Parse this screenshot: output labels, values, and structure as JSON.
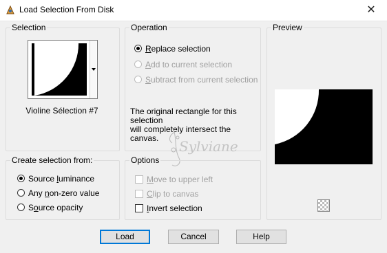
{
  "window": {
    "title": "Load Selection From Disk",
    "close_symbol": "✕",
    "app_icon": "paintshop-app-icon"
  },
  "selection": {
    "group_label": "Selection",
    "name": "Violine Sélection #7"
  },
  "operation": {
    "group_label": "Operation",
    "options": [
      {
        "pre": "",
        "u": "R",
        "post": "eplace selection",
        "checked": true,
        "enabled": true
      },
      {
        "pre": "",
        "u": "A",
        "post": "dd to current selection",
        "checked": false,
        "enabled": false
      },
      {
        "pre": "",
        "u": "S",
        "post": "ubtract from current selection",
        "checked": false,
        "enabled": false
      }
    ],
    "info_line1": "The original rectangle for this selection",
    "info_line2": "will completely intersect the canvas."
  },
  "preview": {
    "group_label": "Preview",
    "transparency_icon": "checkerboard-icon"
  },
  "create_from": {
    "group_label": "Create selection from:",
    "options": [
      {
        "pre": "Source ",
        "u": "l",
        "post": "uminance",
        "checked": true
      },
      {
        "pre": "Any ",
        "u": "n",
        "post": "on-zero value",
        "checked": false
      },
      {
        "pre": "S",
        "u": "o",
        "post": "urce opacity",
        "checked": false
      }
    ]
  },
  "options": {
    "group_label": "Options",
    "items": [
      {
        "pre": "",
        "u": "M",
        "post": "ove to upper left",
        "checked": false,
        "enabled": false
      },
      {
        "pre": "",
        "u": "C",
        "post": "lip to canvas",
        "checked": false,
        "enabled": false
      },
      {
        "pre": "",
        "u": "I",
        "post": "nvert selection",
        "checked": false,
        "enabled": true
      }
    ]
  },
  "buttons": {
    "load": "Load",
    "cancel": "Cancel",
    "help": "Help"
  },
  "watermark": {
    "text": "Sylviane"
  },
  "colors": {
    "window_bg": "#f0f0f0",
    "default_button_border": "#0078d7",
    "disabled_text": "#a0a0a0"
  }
}
